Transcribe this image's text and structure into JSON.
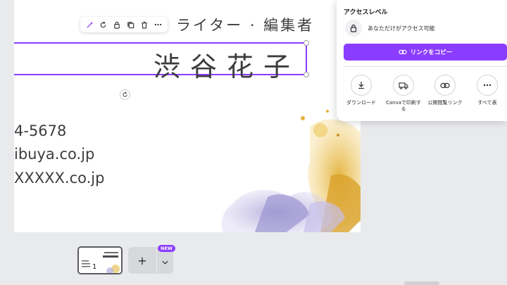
{
  "card": {
    "job_title": "ライター · 編集者",
    "name": "渋谷花子",
    "phone": "4-5678",
    "website": "ibuya.co.jp",
    "email": "XXXXX.co.jp"
  },
  "element_toolbar": {
    "icons": [
      "magic-edit-icon",
      "rotate-icon",
      "lock-icon",
      "duplicate-icon",
      "trash-icon",
      "more-icon"
    ]
  },
  "share_panel": {
    "title": "アクセスレベル",
    "access_text": "あなただけがアクセス可能",
    "copy_link_label": "リンクをコピー",
    "options": [
      {
        "label": "ダウンロード",
        "icon": "download-icon"
      },
      {
        "label": "Canvaで印刷す\nる",
        "icon": "truck-icon"
      },
      {
        "label": "公開閲覧リンク",
        "icon": "link-icon"
      },
      {
        "label": "すべて表",
        "icon": "more-icon"
      }
    ]
  },
  "pages": {
    "current_page": "1",
    "add_label": "+",
    "new_badge": "NEW"
  },
  "colors": {
    "accent": "#8b3dff",
    "canvas_bg": "#ffffff",
    "workspace_bg": "#e9eaec"
  }
}
